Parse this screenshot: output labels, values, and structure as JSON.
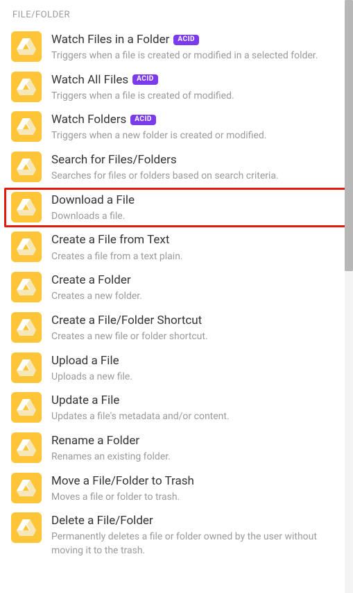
{
  "section": {
    "header": "FILE/FOLDER"
  },
  "badge": {
    "acid": "ACID"
  },
  "icon": {
    "name": "google-drive-icon"
  },
  "items": [
    {
      "title": "Watch Files in a Folder",
      "desc": "Triggers when a file is created or modified in a selected folder.",
      "acid": true,
      "highlight": false
    },
    {
      "title": "Watch All Files",
      "desc": "Triggers when a file is created of modified.",
      "acid": true,
      "highlight": false
    },
    {
      "title": "Watch Folders",
      "desc": "Triggers when a new folder is created or modified.",
      "acid": true,
      "highlight": false
    },
    {
      "title": "Search for Files/Folders",
      "desc": "Searches for files or folders based on search criteria.",
      "acid": false,
      "highlight": false
    },
    {
      "title": "Download a File",
      "desc": "Downloads a file.",
      "acid": false,
      "highlight": true
    },
    {
      "title": "Create a File from Text",
      "desc": "Creates a file from a text plain.",
      "acid": false,
      "highlight": false
    },
    {
      "title": "Create a Folder",
      "desc": "Creates a new folder.",
      "acid": false,
      "highlight": false
    },
    {
      "title": "Create a File/Folder Shortcut",
      "desc": "Creates a new file or folder shortcut.",
      "acid": false,
      "highlight": false
    },
    {
      "title": "Upload a File",
      "desc": "Uploads a new file.",
      "acid": false,
      "highlight": false
    },
    {
      "title": "Update a File",
      "desc": "Updates a file's metadata and/or content.",
      "acid": false,
      "highlight": false
    },
    {
      "title": "Rename a Folder",
      "desc": "Renames an existing folder.",
      "acid": false,
      "highlight": false
    },
    {
      "title": "Move a File/Folder to Trash",
      "desc": "Moves a file or folder to trash.",
      "acid": false,
      "highlight": false
    },
    {
      "title": "Delete a File/Folder",
      "desc": "Permanently deletes a file or folder owned by the user without moving it to the trash.",
      "acid": false,
      "highlight": false
    }
  ]
}
